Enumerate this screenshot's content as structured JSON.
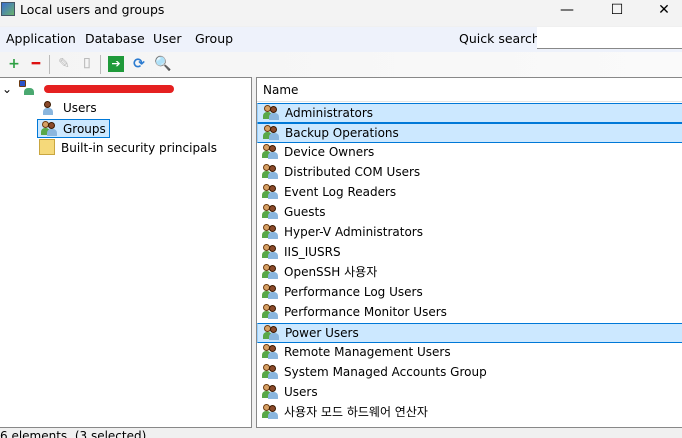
{
  "window": {
    "title": "Local users and groups",
    "minimize": "—",
    "maximize": "☐",
    "close": "✕"
  },
  "menu": [
    "Application",
    "Database",
    "User",
    "Group"
  ],
  "quick_search": {
    "label": "Quick search:",
    "value": "",
    "placeholder": ""
  },
  "toolbar": [
    {
      "icon": "add-icon",
      "glyph": "+",
      "color": "#2ea043",
      "enabled": true
    },
    {
      "icon": "remove-icon",
      "glyph": "━",
      "color": "#d11",
      "enabled": true
    },
    {
      "icon": "edit-icon",
      "glyph": "✎",
      "color": "#bbb",
      "enabled": false
    },
    {
      "icon": "rename-icon",
      "glyph": "⌷",
      "color": "#bbb",
      "enabled": false
    },
    {
      "icon": "go-icon",
      "glyph": "➔",
      "color": "#fff",
      "enabled": true
    },
    {
      "icon": "refresh-icon",
      "glyph": "⟳",
      "color": "#2b7bd0",
      "enabled": true
    },
    {
      "icon": "search-icon",
      "glyph": "🔍",
      "color": "#555",
      "enabled": true
    }
  ],
  "tree": {
    "root_label_redacted": true,
    "items": [
      "Users",
      "Groups",
      "Built-in security principals"
    ],
    "selected": "Groups"
  },
  "list": {
    "column": "Name",
    "rows": [
      {
        "name": "Administrators",
        "selected": true
      },
      {
        "name": "Backup Operations",
        "selected": true
      },
      {
        "name": "Device Owners",
        "selected": false
      },
      {
        "name": "Distributed COM Users",
        "selected": false
      },
      {
        "name": "Event Log Readers",
        "selected": false
      },
      {
        "name": "Guests",
        "selected": false
      },
      {
        "name": "Hyper-V Administrators",
        "selected": false
      },
      {
        "name": "IIS_IUSRS",
        "selected": false
      },
      {
        "name": "OpenSSH 사용자",
        "selected": false
      },
      {
        "name": "Performance Log Users",
        "selected": false
      },
      {
        "name": "Performance Monitor Users",
        "selected": false
      },
      {
        "name": "Power Users",
        "selected": true
      },
      {
        "name": "Remote Management Users",
        "selected": false
      },
      {
        "name": "System Managed Accounts Group",
        "selected": false
      },
      {
        "name": "Users",
        "selected": false
      },
      {
        "name": "사용자 모드 하드웨어 연산자",
        "selected": false
      }
    ]
  },
  "status": "6 elements, (3 selected)",
  "colors": {
    "selection_bg": "#cce8ff",
    "selection_border": "#0078d7",
    "menubar_bg": "#eef2fb"
  }
}
